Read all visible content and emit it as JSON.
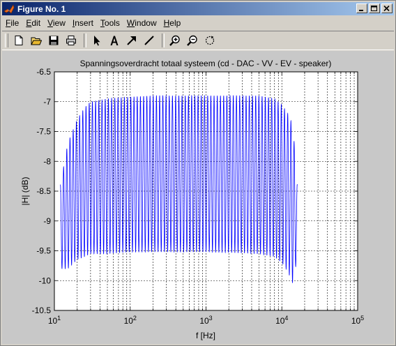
{
  "window": {
    "title": "Figure No. 1",
    "minimize_icon": "minimize-icon",
    "maximize_icon": "maximize-icon",
    "close_icon": "close-icon"
  },
  "menu": [
    {
      "label": "File",
      "accel": "F",
      "rest": "ile"
    },
    {
      "label": "Edit",
      "accel": "E",
      "rest": "dit"
    },
    {
      "label": "View",
      "accel": "V",
      "rest": "iew"
    },
    {
      "label": "Insert",
      "accel": "I",
      "rest": "nsert"
    },
    {
      "label": "Tools",
      "accel": "T",
      "rest": "ools"
    },
    {
      "label": "Window",
      "accel": "W",
      "rest": "indow"
    },
    {
      "label": "Help",
      "accel": "H",
      "rest": "elp"
    }
  ],
  "toolbar": [
    "new-file-icon",
    "open-folder-icon",
    "save-icon",
    "print-icon",
    "select-arrow-icon",
    "text-insert-icon",
    "arrow-insert-icon",
    "line-insert-icon",
    "zoom-in-icon",
    "zoom-out-icon",
    "rotate-icon"
  ],
  "colors": {
    "plot_line": "#0000ff",
    "figure_bg": "#c8c8c8",
    "axes_bg": "#ffffff",
    "title_start": "#0a246a",
    "title_end": "#a6caf0"
  },
  "chart_data": {
    "type": "line",
    "title": "Spanningsoverdracht totaal systeem (cd - DAC - VV - EV - speaker)",
    "xlabel": "f [Hz]",
    "ylabel": "|H| (dB)",
    "xscale": "log",
    "xlim": [
      10,
      100000
    ],
    "ylim": [
      -10.5,
      -6.5
    ],
    "xticks": [
      {
        "base": "10",
        "exp": "1"
      },
      {
        "base": "10",
        "exp": "2"
      },
      {
        "base": "10",
        "exp": "3"
      },
      {
        "base": "10",
        "exp": "4"
      },
      {
        "base": "10",
        "exp": "5"
      }
    ],
    "yticks": [
      "-6.5",
      "-7",
      "-7.5",
      "-8",
      "-8.5",
      "-9",
      "-9.5",
      "-10",
      "-10.5"
    ],
    "grid": true,
    "series": [
      {
        "color": "#0000ff",
        "x_range": [
          12,
          16000
        ],
        "oscillations": 74,
        "envelope_x": [
          12,
          15,
          20,
          25,
          30,
          50,
          100,
          200,
          500,
          1000,
          2000,
          5000,
          8000,
          10000,
          12000,
          14000,
          16000
        ],
        "envelope_max": [
          -8.4,
          -7.7,
          -7.3,
          -7.1,
          -7.0,
          -6.95,
          -6.92,
          -6.9,
          -6.9,
          -6.9,
          -6.9,
          -6.9,
          -6.95,
          -7.05,
          -7.2,
          -7.4,
          -8.4
        ],
        "envelope_min": [
          -9.8,
          -9.8,
          -9.65,
          -9.6,
          -9.55,
          -9.55,
          -9.52,
          -9.52,
          -9.52,
          -9.52,
          -9.53,
          -9.55,
          -9.6,
          -9.7,
          -9.85,
          -10.05,
          -9.6
        ]
      }
    ]
  }
}
